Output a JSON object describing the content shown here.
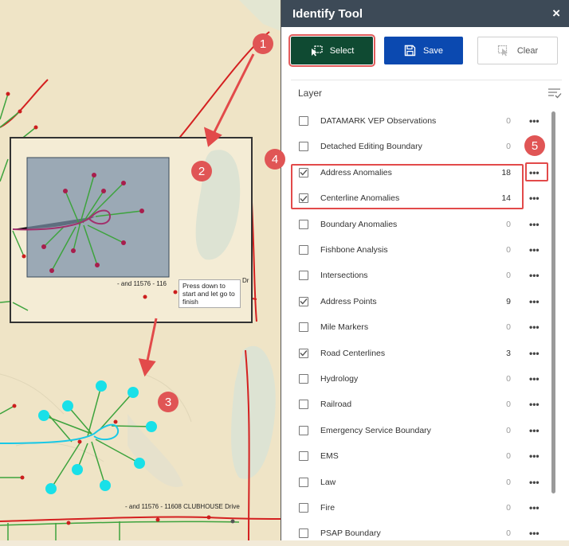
{
  "panel": {
    "title": "Identify Tool",
    "close_glyph": "×",
    "buttons": {
      "select": "Select",
      "save": "Save",
      "clear": "Clear"
    },
    "layer_header": "Layer",
    "layers": [
      {
        "label": "DATAMARK VEP Observations",
        "count": "0",
        "checked": false
      },
      {
        "label": "Detached Editing Boundary",
        "count": "0",
        "checked": false
      },
      {
        "label": "Address Anomalies",
        "count": "18",
        "checked": true
      },
      {
        "label": "Centerline Anomalies",
        "count": "14",
        "checked": true
      },
      {
        "label": "Boundary Anomalies",
        "count": "0",
        "checked": false
      },
      {
        "label": "Fishbone Analysis",
        "count": "0",
        "checked": false
      },
      {
        "label": "Intersections",
        "count": "0",
        "checked": false
      },
      {
        "label": "Address Points",
        "count": "9",
        "checked": true
      },
      {
        "label": "Mile Markers",
        "count": "0",
        "checked": false
      },
      {
        "label": "Road Centerlines",
        "count": "3",
        "checked": true
      },
      {
        "label": "Hydrology",
        "count": "0",
        "checked": false
      },
      {
        "label": "Railroad",
        "count": "0",
        "checked": false
      },
      {
        "label": "Emergency Service Boundary",
        "count": "0",
        "checked": false
      },
      {
        "label": "EMS",
        "count": "0",
        "checked": false
      },
      {
        "label": "Law",
        "count": "0",
        "checked": false
      },
      {
        "label": "Fire",
        "count": "0",
        "checked": false
      },
      {
        "label": "PSAP Boundary",
        "count": "0",
        "checked": false
      }
    ],
    "more_glyph": "•••"
  },
  "map": {
    "tooltip": "Press down to start and let go to finish",
    "street_label_top": "- and 11576 - 116",
    "street_label_top_suffix": "Dr",
    "street_label_bottom": "- and 11576 - 11608 CLUBHOUSE Drive"
  },
  "callouts": [
    "1",
    "2",
    "3",
    "4",
    "5"
  ],
  "colors": {
    "header_bg": "#3d4a57",
    "select_bg": "#0f4a32",
    "save_bg": "#0b49b0",
    "callout": "#e05555",
    "road": "#d42020",
    "selected_point": "#19e0e8",
    "map_bg": "#efe4c6"
  }
}
